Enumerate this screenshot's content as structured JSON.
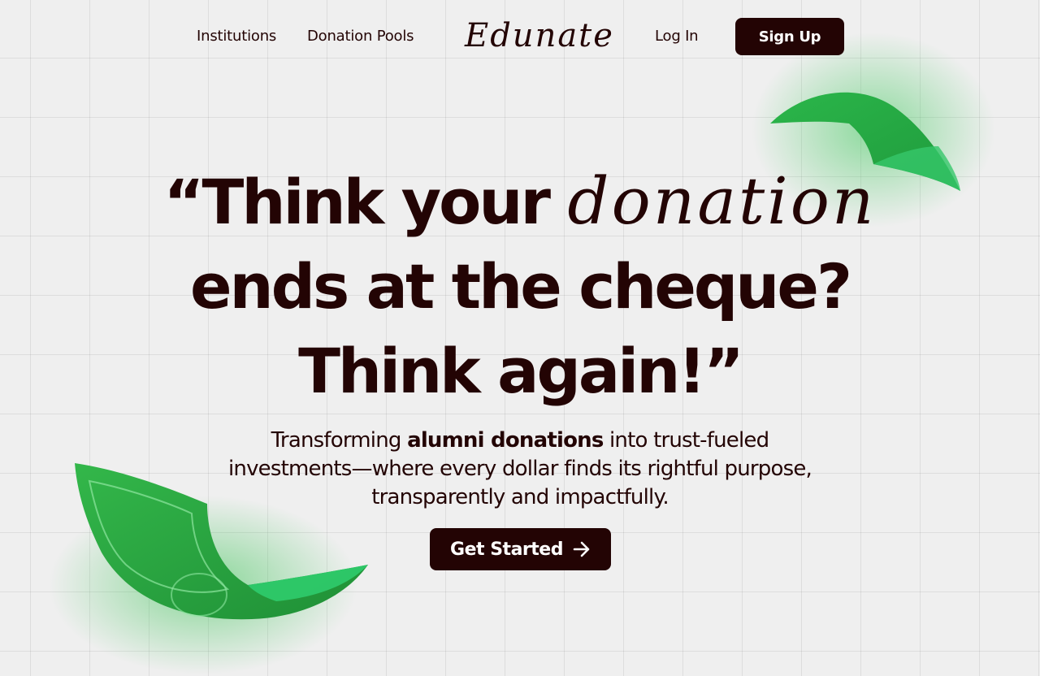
{
  "nav": {
    "institutions": "Institutions",
    "donation_pools": "Donation Pools",
    "logo": "Edunate",
    "login": "Log In",
    "signup": "Sign Up"
  },
  "hero": {
    "line1_a": "“Think your",
    "line1_script": "donation",
    "line2": "ends at the cheque?",
    "line3": "Think again!”",
    "subtitle_a": "Transforming",
    "subtitle_bold": "alumni donations",
    "subtitle_b": "into trust-fueled",
    "subtitle_line2": "investments—where every dollar finds its rightful purpose,",
    "subtitle_line3": "transparently and impactfully.",
    "cta": "Get Started"
  },
  "decorations": {
    "money_icon": "banknote-icon",
    "arrow_icon": "arrow-right-icon"
  },
  "colors": {
    "primary": "#230404",
    "background": "#efefef",
    "money_green": "#2ea844"
  }
}
